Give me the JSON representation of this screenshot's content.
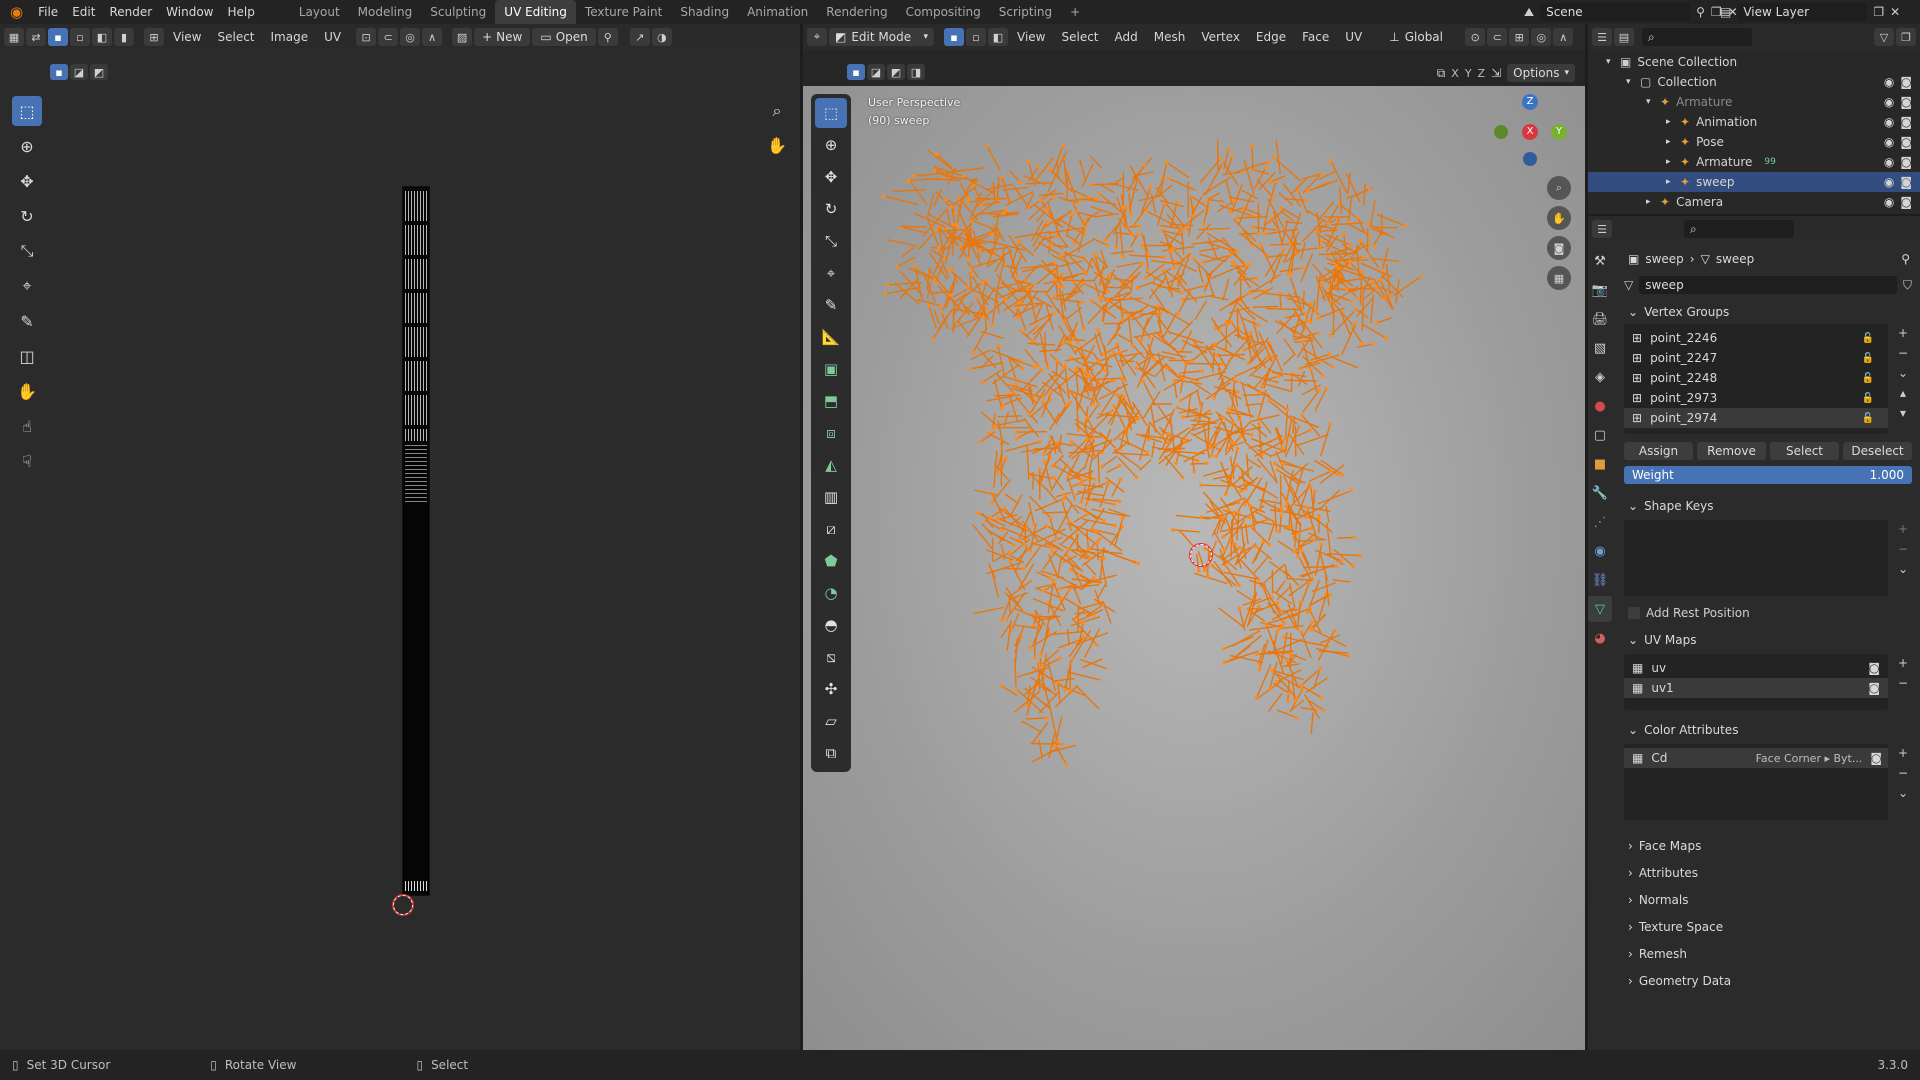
{
  "app": {
    "version": "3.3.0"
  },
  "topbar": {
    "menus": [
      "File",
      "Edit",
      "Render",
      "Window",
      "Help"
    ],
    "workspaces": [
      "Layout",
      "Modeling",
      "Sculpting",
      "UV Editing",
      "Texture Paint",
      "Shading",
      "Animation",
      "Rendering",
      "Compositing",
      "Scripting"
    ],
    "active_workspace": "UV Editing",
    "scene": "Scene",
    "view_layer": "View Layer"
  },
  "uv_editor": {
    "menus": [
      "View",
      "Select",
      "Image",
      "UV"
    ],
    "new_label": "New",
    "open_label": "Open"
  },
  "viewport": {
    "mode": "Edit Mode",
    "menus": [
      "View",
      "Select",
      "Add",
      "Mesh",
      "Vertex",
      "Edge",
      "Face",
      "UV"
    ],
    "orientation": "Global",
    "overlay_title": "User Perspective",
    "overlay_object": "(90) sweep",
    "options_label": "Options",
    "axes": [
      "X",
      "Y",
      "Z"
    ],
    "mesh_color": "#e8760c"
  },
  "outliner": {
    "items": [
      {
        "label": "Scene Collection",
        "indent": 0
      },
      {
        "label": "Collection",
        "indent": 1
      },
      {
        "label": "Armature",
        "indent": 2
      },
      {
        "label": "Animation",
        "indent": 3
      },
      {
        "label": "Pose",
        "indent": 3
      },
      {
        "label": "Armature",
        "indent": 3,
        "badge": "99"
      },
      {
        "label": "sweep",
        "indent": 3
      },
      {
        "label": "Camera",
        "indent": 2
      }
    ]
  },
  "properties": {
    "breadcrumb": [
      "sweep",
      "sweep"
    ],
    "mesh_name": "sweep",
    "vertex_groups": {
      "title": "Vertex Groups",
      "items": [
        "point_2246",
        "point_2247",
        "point_2248",
        "point_2973",
        "point_2974"
      ],
      "buttons": [
        "Assign",
        "Remove",
        "Select",
        "Deselect"
      ],
      "weight_label": "Weight",
      "weight_value": "1.000"
    },
    "shape_keys": {
      "title": "Shape Keys"
    },
    "add_rest_position": "Add Rest Position",
    "uv_maps": {
      "title": "UV Maps",
      "items": [
        "uv",
        "uv1"
      ]
    },
    "color_attributes": {
      "title": "Color Attributes",
      "items": [
        {
          "name": "Cd",
          "meta": "Face Corner ▸ Byt..."
        }
      ]
    },
    "collapsed": [
      "Face Maps",
      "Attributes",
      "Normals",
      "Texture Space",
      "Remesh",
      "Geometry Data"
    ]
  },
  "statusbar": {
    "items": [
      "Set 3D Cursor",
      "Rotate View",
      "Select"
    ],
    "version": "3.3.0"
  }
}
